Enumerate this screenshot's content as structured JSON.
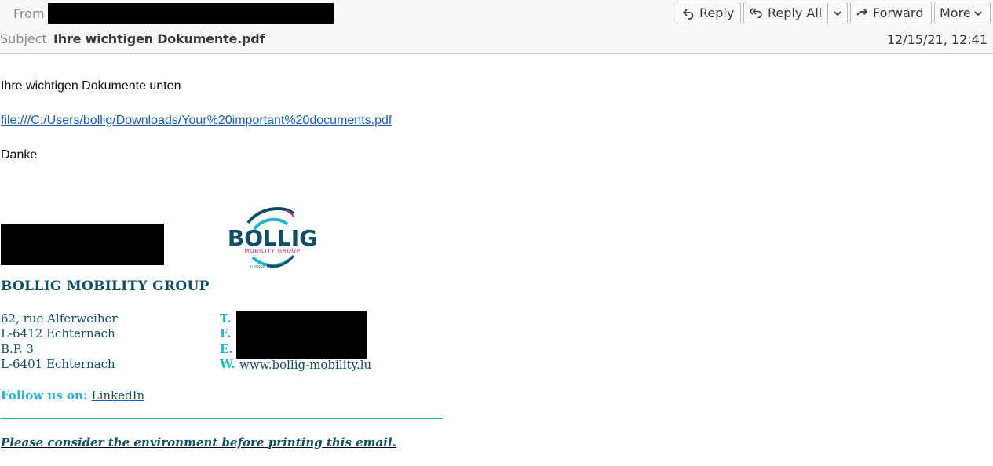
{
  "header": {
    "from_label": "From",
    "from_value": "[redacted]",
    "subject_label": "Subject",
    "subject": "Ihre wichtigen Dokumente.pdf",
    "date": "12/15/21, 12:41",
    "buttons": {
      "reply": "Reply",
      "reply_all": "Reply All",
      "forward": "Forward",
      "more": "More"
    },
    "icons": {
      "reply": "reply-arrow-icon",
      "reply_all": "reply-all-arrow-icon",
      "forward": "forward-arrow-icon",
      "dropdown": "chevron-down-icon"
    }
  },
  "message": {
    "line1": "Ihre wichtigen Dokumente unten",
    "link": "file:///C:/Users/bollig/Downloads/Your%20important%20documents.pdf",
    "line3": "Danke"
  },
  "signature": {
    "name": "[redacted]",
    "logo": {
      "wordmark": "BOLLIG",
      "subtitle": "MOBILITY GROUP",
      "tagline": "in motion. together.",
      "colors": {
        "primary": "#0f4f66",
        "accent": "#22b4c8",
        "pink": "#e0207a"
      }
    },
    "company": "BOLLIG MOBILITY GROUP",
    "address": [
      "62, rue Alferweiher",
      "L-6412 Echternach",
      "B.P. 3",
      "L-6401 Echternach"
    ],
    "contact_labels": [
      "T.",
      "F.",
      "E.",
      "W."
    ],
    "contact_redacted": "[redacted]",
    "website": "www.bollig-mobility.lu",
    "follow_label": "Follow us on:",
    "follow_link": "LinkedIn",
    "environment_note": "Please consider the environment before printing this email."
  },
  "colors": {
    "link": "#1a5fb4",
    "signature_text": "#0f4f66",
    "signature_accent": "#22b4c8"
  }
}
